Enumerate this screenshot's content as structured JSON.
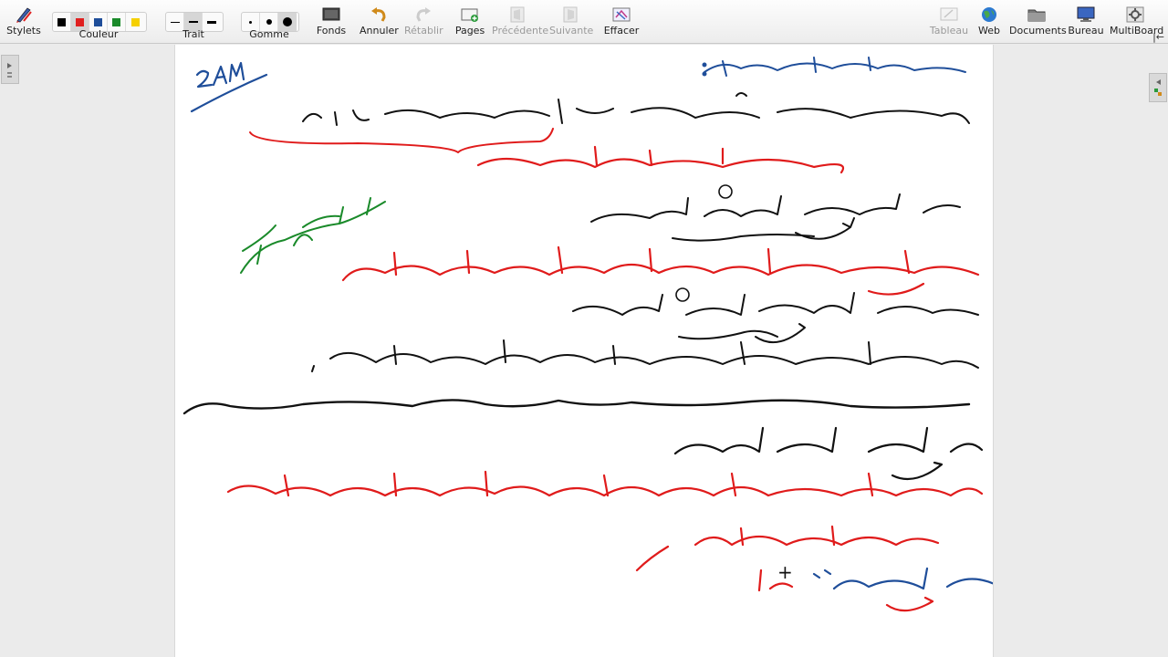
{
  "toolbar": {
    "left": [
      {
        "id": "stylets",
        "label": "Stylets",
        "icon": "pen-icon"
      },
      {
        "id": "fonds",
        "label": "Fonds",
        "icon": "background-icon"
      },
      {
        "id": "annuler",
        "label": "Annuler",
        "icon": "undo-icon"
      },
      {
        "id": "retablir",
        "label": "Rétablir",
        "icon": "redo-icon",
        "disabled": true
      },
      {
        "id": "pages",
        "label": "Pages",
        "icon": "add-page-icon"
      },
      {
        "id": "precedente",
        "label": "Précédente",
        "icon": "previous-page-icon",
        "disabled": true
      },
      {
        "id": "suivante",
        "label": "Suivante",
        "icon": "next-page-icon",
        "disabled": true
      },
      {
        "id": "effacer",
        "label": "Effacer",
        "icon": "clear-icon"
      }
    ],
    "couleur": {
      "label": "Couleur",
      "colors": [
        "#000000",
        "#e02020",
        "#1f4e9a",
        "#1a8a2a",
        "#f5d000"
      ],
      "selected": 1
    },
    "trait": {
      "label": "Trait"
    },
    "gomme": {
      "label": "Gomme"
    },
    "right": [
      {
        "id": "tableau",
        "label": "Tableau",
        "icon": "board-icon",
        "disabled": true
      },
      {
        "id": "web",
        "label": "Web",
        "icon": "globe-icon"
      },
      {
        "id": "documents",
        "label": "Documents",
        "icon": "folder-icon"
      },
      {
        "id": "bureau",
        "label": "Bureau",
        "icon": "desktop-icon"
      },
      {
        "id": "multiboard",
        "label": "MultiBoard",
        "icon": "settings-icon"
      }
    ]
  },
  "ink_colors": {
    "blue": "#1f4e9a",
    "black": "#111111",
    "red": "#e01b1b",
    "green": "#1a8a2a"
  }
}
